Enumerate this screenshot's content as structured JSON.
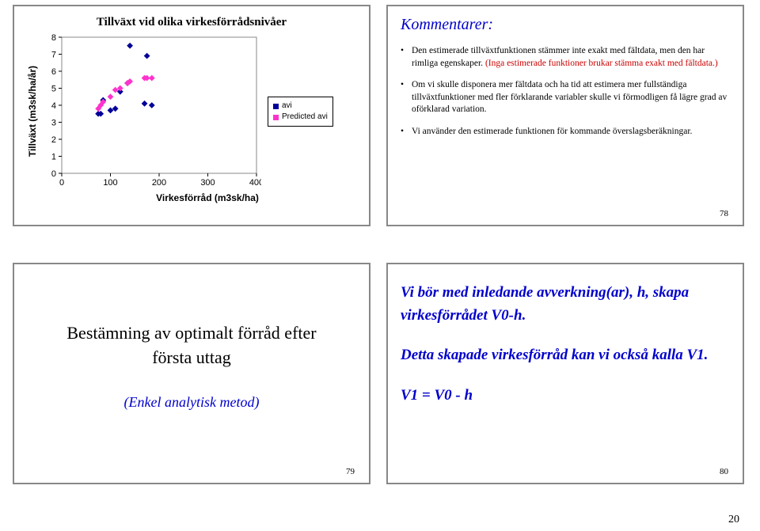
{
  "chart_data": {
    "type": "scatter",
    "title": "Tillväxt vid olika virkesförrådsnivåer",
    "xlabel": "Virkesförråd (m3sk/ha)",
    "ylabel": "Tillväxt (m3sk/ha/år)",
    "xlim": [
      0,
      400
    ],
    "ylim": [
      0,
      8
    ],
    "xticks": [
      0,
      100,
      200,
      300,
      400
    ],
    "yticks": [
      0,
      1,
      2,
      3,
      4,
      5,
      6,
      7,
      8
    ],
    "series": [
      {
        "name": "avi",
        "color": "#000099",
        "points": [
          {
            "x": 75,
            "y": 3.5
          },
          {
            "x": 80,
            "y": 3.5
          },
          {
            "x": 85,
            "y": 4.3
          },
          {
            "x": 100,
            "y": 3.7
          },
          {
            "x": 110,
            "y": 3.8
          },
          {
            "x": 120,
            "y": 4.8
          },
          {
            "x": 135,
            "y": 5.3
          },
          {
            "x": 140,
            "y": 7.5
          },
          {
            "x": 170,
            "y": 4.1
          },
          {
            "x": 175,
            "y": 6.9
          },
          {
            "x": 185,
            "y": 4.0
          }
        ]
      },
      {
        "name": "Predicted avi",
        "color": "#ff33cc",
        "points": [
          {
            "x": 75,
            "y": 3.8
          },
          {
            "x": 80,
            "y": 4.0
          },
          {
            "x": 85,
            "y": 4.2
          },
          {
            "x": 100,
            "y": 4.5
          },
          {
            "x": 110,
            "y": 4.9
          },
          {
            "x": 120,
            "y": 5.0
          },
          {
            "x": 135,
            "y": 5.3
          },
          {
            "x": 140,
            "y": 5.4
          },
          {
            "x": 170,
            "y": 5.6
          },
          {
            "x": 175,
            "y": 5.6
          },
          {
            "x": 185,
            "y": 5.6
          }
        ]
      }
    ],
    "legend": {
      "items": [
        "avi",
        "Predicted avi"
      ]
    }
  },
  "slide_tr": {
    "title": "Kommentarer:",
    "bullets": [
      {
        "text": "Den estimerade tillväxtfunktionen stämmer inte exakt med fältdata, men den har rimliga egenskaper. ",
        "red_tail": "(Inga estimerade funktioner brukar stämma exakt med fältdata.)"
      },
      {
        "text": "Om vi skulle disponera mer fältdata och ha tid att estimera mer fullständiga tillväxtfunktioner med fler förklarande variabler skulle vi förmodligen få lägre grad av oförklarad variation.",
        "red_tail": ""
      },
      {
        "text": "Vi använder den estimerade funktionen för kommande överslagsberäkningar.",
        "red_tail": ""
      }
    ],
    "page": "78"
  },
  "slide_bl": {
    "heading_line1": "Bestämning av optimalt förråd efter",
    "heading_line2": "första uttag",
    "subtitle": "(Enkel analytisk metod)",
    "page": "79"
  },
  "slide_br": {
    "p1": "Vi bör med inledande avverkning(ar), h, skapa virkesförrådet V0-h.",
    "p2": "Detta skapade virkesförråd kan vi också kalla V1.",
    "p3": "V1 = V0 - h",
    "page": "80"
  },
  "outer_page": "20"
}
